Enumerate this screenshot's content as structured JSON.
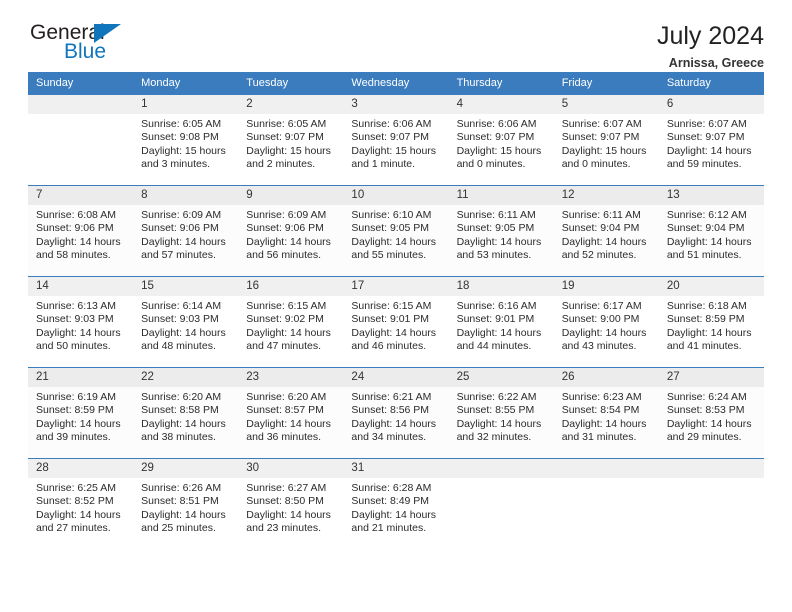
{
  "brand": {
    "word_one": "General",
    "word_two": "Blue",
    "triangle_icon": "blue-triangle-icon",
    "accent_color": "#1175bc"
  },
  "header": {
    "title": "July 2024",
    "subtitle": "Arnissa, Greece",
    "header_bg_color": "#3a7cbe"
  },
  "labels": {
    "sunrise": "Sunrise:",
    "sunset": "Sunset:",
    "daylight": "Daylight:"
  },
  "weekdays": [
    "Sunday",
    "Monday",
    "Tuesday",
    "Wednesday",
    "Thursday",
    "Friday",
    "Saturday"
  ],
  "weeks": [
    [
      {
        "day": ""
      },
      {
        "day": "1",
        "sunrise": "Sunrise: 6:05 AM",
        "sunset": "Sunset: 9:08 PM",
        "daylight_1": "Daylight: 15 hours",
        "daylight_2": "and 3 minutes."
      },
      {
        "day": "2",
        "sunrise": "Sunrise: 6:05 AM",
        "sunset": "Sunset: 9:07 PM",
        "daylight_1": "Daylight: 15 hours",
        "daylight_2": "and 2 minutes."
      },
      {
        "day": "3",
        "sunrise": "Sunrise: 6:06 AM",
        "sunset": "Sunset: 9:07 PM",
        "daylight_1": "Daylight: 15 hours",
        "daylight_2": "and 1 minute."
      },
      {
        "day": "4",
        "sunrise": "Sunrise: 6:06 AM",
        "sunset": "Sunset: 9:07 PM",
        "daylight_1": "Daylight: 15 hours",
        "daylight_2": "and 0 minutes."
      },
      {
        "day": "5",
        "sunrise": "Sunrise: 6:07 AM",
        "sunset": "Sunset: 9:07 PM",
        "daylight_1": "Daylight: 15 hours",
        "daylight_2": "and 0 minutes."
      },
      {
        "day": "6",
        "sunrise": "Sunrise: 6:07 AM",
        "sunset": "Sunset: 9:07 PM",
        "daylight_1": "Daylight: 14 hours",
        "daylight_2": "and 59 minutes."
      }
    ],
    [
      {
        "day": "7",
        "sunrise": "Sunrise: 6:08 AM",
        "sunset": "Sunset: 9:06 PM",
        "daylight_1": "Daylight: 14 hours",
        "daylight_2": "and 58 minutes."
      },
      {
        "day": "8",
        "sunrise": "Sunrise: 6:09 AM",
        "sunset": "Sunset: 9:06 PM",
        "daylight_1": "Daylight: 14 hours",
        "daylight_2": "and 57 minutes."
      },
      {
        "day": "9",
        "sunrise": "Sunrise: 6:09 AM",
        "sunset": "Sunset: 9:06 PM",
        "daylight_1": "Daylight: 14 hours",
        "daylight_2": "and 56 minutes."
      },
      {
        "day": "10",
        "sunrise": "Sunrise: 6:10 AM",
        "sunset": "Sunset: 9:05 PM",
        "daylight_1": "Daylight: 14 hours",
        "daylight_2": "and 55 minutes."
      },
      {
        "day": "11",
        "sunrise": "Sunrise: 6:11 AM",
        "sunset": "Sunset: 9:05 PM",
        "daylight_1": "Daylight: 14 hours",
        "daylight_2": "and 53 minutes."
      },
      {
        "day": "12",
        "sunrise": "Sunrise: 6:11 AM",
        "sunset": "Sunset: 9:04 PM",
        "daylight_1": "Daylight: 14 hours",
        "daylight_2": "and 52 minutes."
      },
      {
        "day": "13",
        "sunrise": "Sunrise: 6:12 AM",
        "sunset": "Sunset: 9:04 PM",
        "daylight_1": "Daylight: 14 hours",
        "daylight_2": "and 51 minutes."
      }
    ],
    [
      {
        "day": "14",
        "sunrise": "Sunrise: 6:13 AM",
        "sunset": "Sunset: 9:03 PM",
        "daylight_1": "Daylight: 14 hours",
        "daylight_2": "and 50 minutes."
      },
      {
        "day": "15",
        "sunrise": "Sunrise: 6:14 AM",
        "sunset": "Sunset: 9:03 PM",
        "daylight_1": "Daylight: 14 hours",
        "daylight_2": "and 48 minutes."
      },
      {
        "day": "16",
        "sunrise": "Sunrise: 6:15 AM",
        "sunset": "Sunset: 9:02 PM",
        "daylight_1": "Daylight: 14 hours",
        "daylight_2": "and 47 minutes."
      },
      {
        "day": "17",
        "sunrise": "Sunrise: 6:15 AM",
        "sunset": "Sunset: 9:01 PM",
        "daylight_1": "Daylight: 14 hours",
        "daylight_2": "and 46 minutes."
      },
      {
        "day": "18",
        "sunrise": "Sunrise: 6:16 AM",
        "sunset": "Sunset: 9:01 PM",
        "daylight_1": "Daylight: 14 hours",
        "daylight_2": "and 44 minutes."
      },
      {
        "day": "19",
        "sunrise": "Sunrise: 6:17 AM",
        "sunset": "Sunset: 9:00 PM",
        "daylight_1": "Daylight: 14 hours",
        "daylight_2": "and 43 minutes."
      },
      {
        "day": "20",
        "sunrise": "Sunrise: 6:18 AM",
        "sunset": "Sunset: 8:59 PM",
        "daylight_1": "Daylight: 14 hours",
        "daylight_2": "and 41 minutes."
      }
    ],
    [
      {
        "day": "21",
        "sunrise": "Sunrise: 6:19 AM",
        "sunset": "Sunset: 8:59 PM",
        "daylight_1": "Daylight: 14 hours",
        "daylight_2": "and 39 minutes."
      },
      {
        "day": "22",
        "sunrise": "Sunrise: 6:20 AM",
        "sunset": "Sunset: 8:58 PM",
        "daylight_1": "Daylight: 14 hours",
        "daylight_2": "and 38 minutes."
      },
      {
        "day": "23",
        "sunrise": "Sunrise: 6:20 AM",
        "sunset": "Sunset: 8:57 PM",
        "daylight_1": "Daylight: 14 hours",
        "daylight_2": "and 36 minutes."
      },
      {
        "day": "24",
        "sunrise": "Sunrise: 6:21 AM",
        "sunset": "Sunset: 8:56 PM",
        "daylight_1": "Daylight: 14 hours",
        "daylight_2": "and 34 minutes."
      },
      {
        "day": "25",
        "sunrise": "Sunrise: 6:22 AM",
        "sunset": "Sunset: 8:55 PM",
        "daylight_1": "Daylight: 14 hours",
        "daylight_2": "and 32 minutes."
      },
      {
        "day": "26",
        "sunrise": "Sunrise: 6:23 AM",
        "sunset": "Sunset: 8:54 PM",
        "daylight_1": "Daylight: 14 hours",
        "daylight_2": "and 31 minutes."
      },
      {
        "day": "27",
        "sunrise": "Sunrise: 6:24 AM",
        "sunset": "Sunset: 8:53 PM",
        "daylight_1": "Daylight: 14 hours",
        "daylight_2": "and 29 minutes."
      }
    ],
    [
      {
        "day": "28",
        "sunrise": "Sunrise: 6:25 AM",
        "sunset": "Sunset: 8:52 PM",
        "daylight_1": "Daylight: 14 hours",
        "daylight_2": "and 27 minutes."
      },
      {
        "day": "29",
        "sunrise": "Sunrise: 6:26 AM",
        "sunset": "Sunset: 8:51 PM",
        "daylight_1": "Daylight: 14 hours",
        "daylight_2": "and 25 minutes."
      },
      {
        "day": "30",
        "sunrise": "Sunrise: 6:27 AM",
        "sunset": "Sunset: 8:50 PM",
        "daylight_1": "Daylight: 14 hours",
        "daylight_2": "and 23 minutes."
      },
      {
        "day": "31",
        "sunrise": "Sunrise: 6:28 AM",
        "sunset": "Sunset: 8:49 PM",
        "daylight_1": "Daylight: 14 hours",
        "daylight_2": "and 21 minutes."
      },
      {
        "day": ""
      },
      {
        "day": ""
      },
      {
        "day": ""
      }
    ]
  ]
}
